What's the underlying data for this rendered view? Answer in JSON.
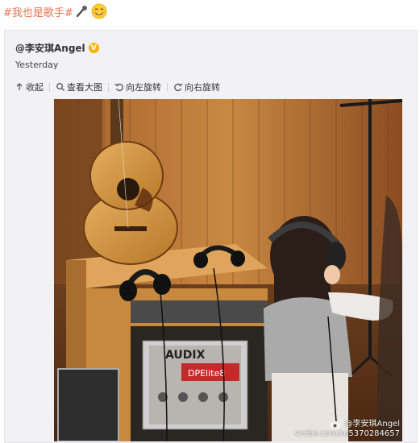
{
  "post": {
    "hashtag": "#我也是歌手#",
    "emoji_mic": "microphone-emoji",
    "emoji_face": "smiling-face-emoji"
  },
  "card": {
    "author": "@李安琪Angel",
    "verified_icon": "verified-badge-icon",
    "timestamp": "Yesterday"
  },
  "toolbar": {
    "items": [
      {
        "label": "收起",
        "icon": "collapse-icon"
      },
      {
        "label": "查看大图",
        "icon": "search-icon"
      },
      {
        "label": "向左旋转",
        "icon": "rotate-left-icon"
      },
      {
        "label": "向右旋转",
        "icon": "rotate-right-icon"
      }
    ]
  },
  "photo": {
    "amp_brand": "AUDIX",
    "amp_model": "DPElite8",
    "watermark_name": "@李安琪Angel",
    "watermark_url": "weibo.com/u/5370284657"
  },
  "colors": {
    "hashtag": "#eb7350",
    "card_bg": "#f2f2f5",
    "verified": "#f5b300"
  }
}
